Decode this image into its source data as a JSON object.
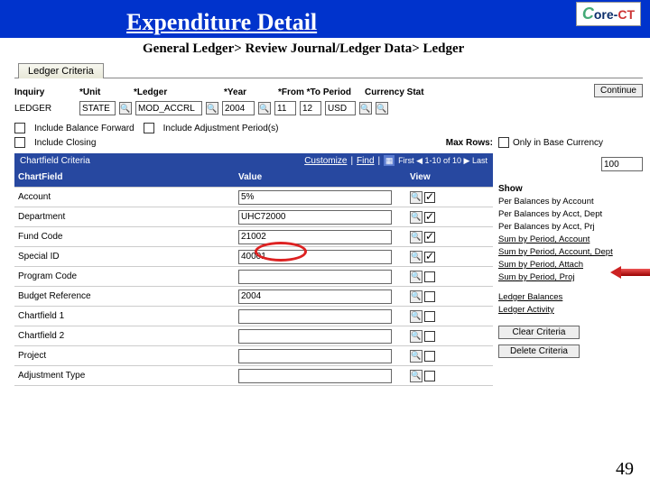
{
  "header": {
    "title": "Expenditure Detail",
    "logo": "Core-CT"
  },
  "breadcrumb": "General Ledger> Review Journal/Ledger Data> Ledger",
  "tab": "Ledger Criteria",
  "criteria": {
    "inquiry_lbl": "Inquiry",
    "inquiry_val": "LEDGER",
    "unit_lbl": "*Unit",
    "unit_val": "STATE",
    "ledger_lbl": "*Ledger",
    "ledger_val": "MOD_ACCRL",
    "year_lbl": "*Year",
    "year_val": "2004",
    "from_to_lbl": "*From *To Period",
    "from_val": "11",
    "to_val": "12",
    "curr_lbl": "Currency Stat",
    "curr_val": "USD",
    "continue_btn": "Continue",
    "include_balance_forward": "Include Balance Forward",
    "include_adjustment": "Include Adjustment Period(s)",
    "only_base": "Only in Base Currency",
    "include_closing": "Include Closing",
    "max_rows_lbl": "Max Rows:",
    "max_rows_val": "100"
  },
  "chartfield": {
    "section_title": "Chartfield Criteria",
    "customize": "Customize",
    "find": "Find",
    "nav_text": "First ◀ 1-10 of 10 ▶ Last",
    "col_chart": "ChartField",
    "col_value": "Value",
    "col_view": "View",
    "rows": [
      {
        "label": "Account",
        "value": "5%",
        "checked": true
      },
      {
        "label": "Department",
        "value": "UHC72000",
        "checked": true
      },
      {
        "label": "Fund Code",
        "value": "21002",
        "checked": true
      },
      {
        "label": "Special ID",
        "value": "40001",
        "checked": true
      },
      {
        "label": "Program Code",
        "value": "",
        "checked": false
      },
      {
        "label": "Budget Reference",
        "value": "2004",
        "checked": false
      },
      {
        "label": "Chartfield 1",
        "value": "",
        "checked": false
      },
      {
        "label": "Chartfield 2",
        "value": "",
        "checked": false
      },
      {
        "label": "Project",
        "value": "",
        "checked": false
      },
      {
        "label": "Adjustment Type",
        "value": "",
        "checked": false
      }
    ]
  },
  "show": {
    "heading": "Show",
    "options": [
      "Per Balances by Account",
      "Per Balances by Acct, Dept",
      "Per Balances by Acct, Prj",
      "Sum by Period, Account",
      "Sum by Period, Account, Dept",
      "Sum by Period, Attach",
      "Sum by Period, Proj"
    ],
    "ledger_balances": "Ledger Balances",
    "ledger_activity": "Ledger Activity",
    "clear_btn": "Clear Criteria",
    "delete_btn": "Delete Criteria"
  },
  "page_number": "49"
}
